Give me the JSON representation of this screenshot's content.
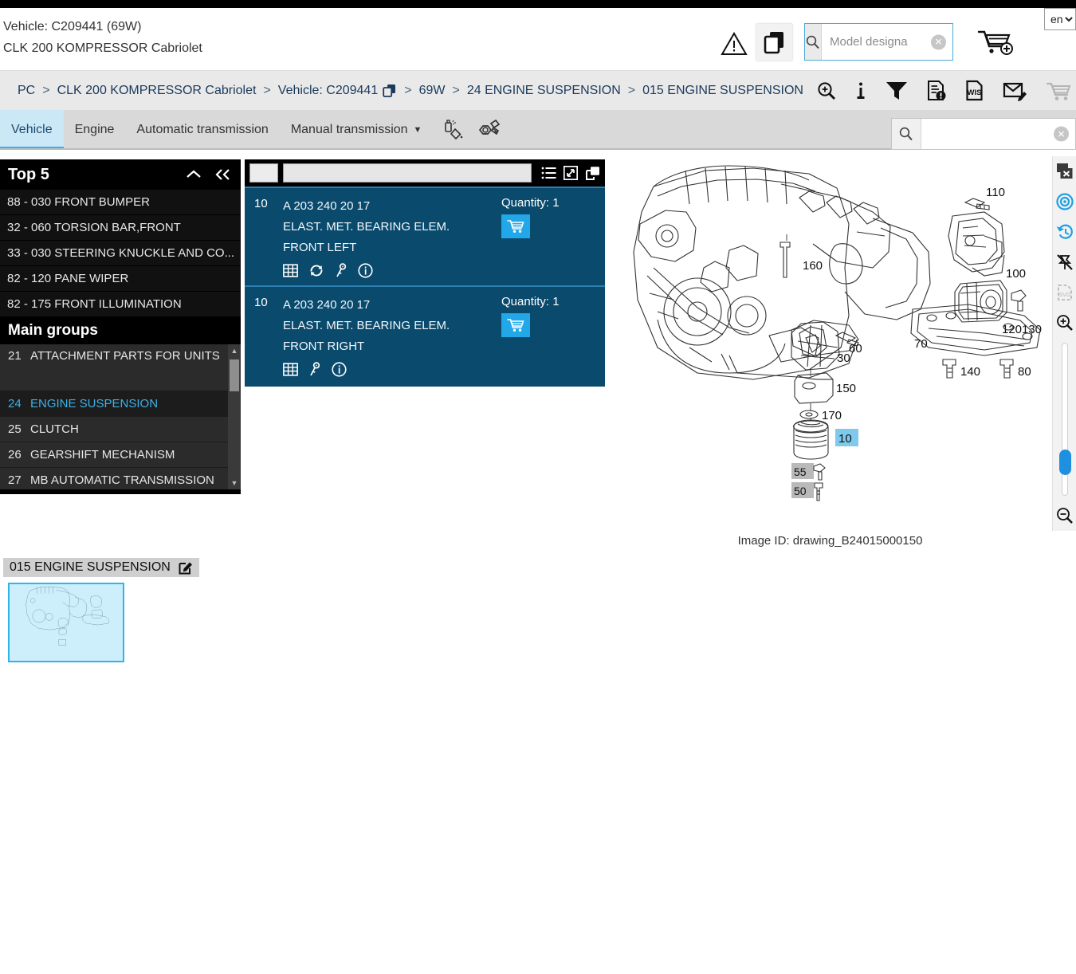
{
  "header": {
    "vehicle_line1": "Vehicle: C209441 (69W)",
    "vehicle_line2": "CLK 200 KOMPRESSOR Cabriolet",
    "warning_icon": "warning-triangle-icon",
    "copy_icon": "copy-icon",
    "cart_icon": "cart-add-icon",
    "language": "en",
    "search": {
      "value": "",
      "placeholder": "Model designa"
    }
  },
  "breadcrumb": {
    "items": [
      "PC",
      "CLK 200 KOMPRESSOR Cabriolet",
      "Vehicle: C209441",
      "69W",
      "24 ENGINE SUSPENSION",
      "015 ENGINE SUSPENSION"
    ],
    "separator": ">",
    "tools": [
      "zoom-search-icon",
      "info-icon",
      "filter-funnel-icon",
      "document-alert-icon",
      "wis-document-icon",
      "mail-edit-icon",
      "cart-icon"
    ]
  },
  "tabs": {
    "items": [
      {
        "label": "Vehicle",
        "active": true,
        "caret": false
      },
      {
        "label": "Engine",
        "active": false,
        "caret": false
      },
      {
        "label": "Automatic transmission",
        "active": false,
        "caret": false
      },
      {
        "label": "Manual transmission",
        "active": false,
        "caret": true
      }
    ],
    "icons": [
      "spray-paint-icon",
      "bolt-nut-icon"
    ],
    "search": {
      "value": "",
      "placeholder": ""
    }
  },
  "sidebar": {
    "top5_title": "Top 5",
    "collapse_icon": "chevron-up-icon",
    "collapse_all_icon": "chevron-double-left-icon",
    "top5_items": [
      "88 - 030 FRONT BUMPER",
      "32 - 060 TORSION BAR,FRONT",
      "33 - 030 STEERING KNUCKLE AND CO...",
      "82 - 120 PANE WIPER",
      "82 - 175 FRONT ILLUMINATION"
    ],
    "main_groups_title": "Main groups",
    "main_groups": [
      {
        "num": "21",
        "label": "ATTACHMENT PARTS FOR UNITS",
        "active": false,
        "tall": true
      },
      {
        "num": "24",
        "label": "ENGINE SUSPENSION",
        "active": true,
        "tall": false
      },
      {
        "num": "25",
        "label": "CLUTCH",
        "active": false,
        "tall": false
      },
      {
        "num": "26",
        "label": "GEARSHIFT MECHANISM",
        "active": false,
        "tall": false
      },
      {
        "num": "27",
        "label": "MB AUTOMATIC TRANSMISSION",
        "active": false,
        "tall": false
      }
    ]
  },
  "parts_panel": {
    "toolbar_icons": [
      "list-view-icon",
      "expand-icon",
      "copy-icon"
    ],
    "filter_value": "",
    "rows": [
      {
        "num": "10",
        "part_number": "A 203 240 20 17",
        "description": "ELAST. MET. BEARING ELEM.",
        "position": "FRONT LEFT",
        "quantity_label": "Quantity: 1",
        "cart_icon": "cart-icon",
        "icons": [
          "grid-table-icon",
          "exchange-arrows-icon",
          "key-icon",
          "info-circle-icon"
        ]
      },
      {
        "num": "10",
        "part_number": "A 203 240 20 17",
        "description": "ELAST. MET. BEARING ELEM.",
        "position": "FRONT RIGHT",
        "quantity_label": "Quantity: 1",
        "cart_icon": "cart-icon",
        "icons": [
          "grid-table-icon",
          "key-icon",
          "info-circle-icon"
        ]
      }
    ]
  },
  "drawing": {
    "image_id": "Image ID: drawing_B24015000150",
    "callouts": [
      "110",
      "100",
      "120",
      "130",
      "160",
      "60",
      "30",
      "70",
      "140",
      "80",
      "150",
      "170",
      "10",
      "55",
      "50"
    ],
    "selected_callout": "10",
    "gray_callouts": [
      "55",
      "50"
    ]
  },
  "tool_rail": {
    "buttons": [
      "window-close-icon",
      "target-focus-icon",
      "history-undo-icon",
      "unpin-icon",
      "svg-file-icon",
      "zoom-in-icon",
      "zoom-out-icon"
    ],
    "slider_value": 12
  },
  "thumbnail": {
    "label": "015 ENGINE SUSPENSION",
    "edit_icon": "edit-pencil-icon"
  },
  "colors": {
    "accent_blue": "#22a7e8",
    "panel_blue": "#0a4a6c",
    "tab_active": "#cbe8f7",
    "link_blue": "#1b3a5c",
    "thumb_bg": "#cdeefb"
  }
}
